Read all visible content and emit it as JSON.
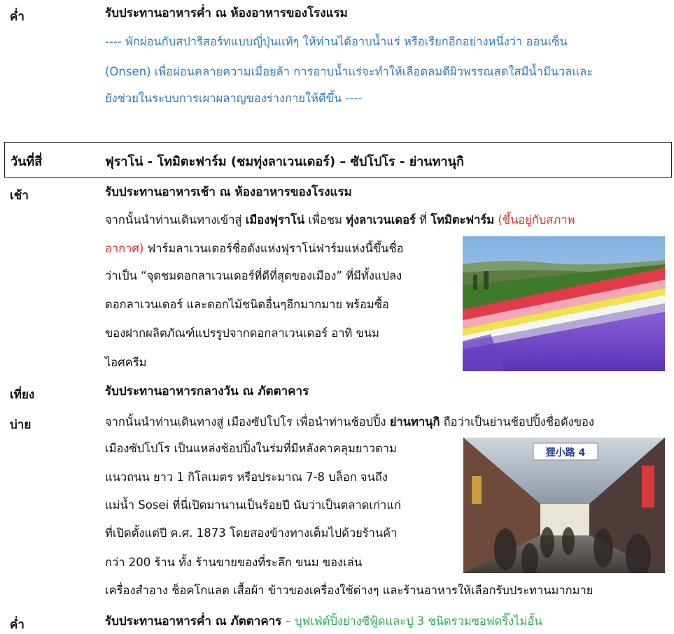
{
  "dinner1": {
    "label": "ค่ำ",
    "title": "รับประทานอาหารค่ำ ณ ห้องอาหารของโรงแรม",
    "note_lines": [
      "----  พักผ่อนกับสปารีสอร์ทแบบญี่ปุ่นแท้ๆ  ให้ท่านได้อาบน้ำแร่ หรือเรียกอีกอย่างหนึ่งว่า ออนเซ็น",
      "(Onsen) เพื่อผ่อนคลายความเมื่อยล้า การอาบน้ำแร่จะทำให้เลือดลมดีผิวพรรณสดใสมีน้ำมีนวลและ",
      "ยังช่วยในระบบการเผาผลาญของร่างกายให้ดีขึ้น ----"
    ]
  },
  "day4": {
    "label": "วันที่สี่",
    "title": "ฟุราโน่ - โทมิตะฟาร์ม (ชมทุ่งลาเวนเดอร์) – ซัปโปโร - ย่านทานุกิ"
  },
  "morning": {
    "label": "เช้า",
    "title": "รับประทานอาหารเช้า ณ ห้องอาหารของโรงแรม",
    "l1_a": "จากนั้นนำท่านเดินทางเข้าสู่ ",
    "l1_b": "เมืองฟุราโน่",
    "l1_c": " เพื่อชม ",
    "l1_d": "ทุ่งลาเวนเดอร์",
    "l1_e": " ที่ ",
    "l1_f": "โทมิตะฟาร์ม",
    "l1_g": " (ขึ้นอยู่กับสภาพ",
    "l2_red": "อากาศ)",
    "l2_rest": " ฟาร์มลาเวนเดอร์ชื่อดังแห่งฟุราโน่ฟาร์มแห่งนี้ขึ้นชื่อ",
    "lines": [
      "ว่าเป็น “จุดชมดอกลาเวนเดอร์ที่ดีที่สุดของเมือง” ที่มีทั้งแปลง",
      "ดอกลาเวนเดอร์ และดอกไม้ชนิดอื่นๆอีกมากมาย พร้อมซื้อ",
      "ของฝากผลิตภัณฑ์แปรรูปจากดอกลาเวนเดอร์ อาทิ ขนม",
      "ไอศครีม"
    ]
  },
  "lunch": {
    "label": "เที่ยง",
    "title": "รับประทานอาหารกลางวัน ณ ภัตตาคาร"
  },
  "afternoon": {
    "label": "บ่าย",
    "l1_a": "จากนั้นนำท่านเดินทางสู่ เมืองซัปโปโร เพื่อนำท่านช้อปปิ้ง ",
    "l1_b": "ย่านทานุกิ",
    "l1_c": " ถือว่าเป็นย่านช้อปปิ้งชื่อดังของ",
    "lines": [
      "เมืองซัปโปโร เป็นแหล่งช้อปปิ้งในร่มที่มีหลังคาคลุมยาวตาม",
      "แนวถนน ยาว 1 กิโลเมตร หรือประมาณ 7-8 บล็อก จนถึง",
      "แม่น้ำ Sosei ที่นี่เปิดมานานเป็นร้อยปี นับว่าเป็นตลาดเก่าแก่",
      "ที่เปิดตั้งแต่ปี ค.ศ. 1873 โดยสองข้างทางเต็มไปด้วยร้านค้า",
      "กว่า 200 ร้าน ทั้ง ร้านขายของที่ระลึก ขนม ของเล่น"
    ],
    "last_line": "เครื่องสำอาง ช็อคโกแลต เสื้อผ้า ข้าวของเครื่องใช้ต่างๆ และร้านอาหารให้เลือกรับประทานมากมาย",
    "sign_text": "狸小路 4"
  },
  "dinner2": {
    "label": "ค่ำ",
    "title": "รับประทานอาหารค่ำ ณ ภัตตาคาร",
    "extra": " – บุฟเฟ่ต์ปิ้งย่างซีฟู้ดและปู 3 ชนิดรวมซอฟดริ๊งไม่อั้น"
  },
  "colors": {
    "note_blue": "#2e7cc7",
    "weather_red": "#e0302a",
    "buffet_green": "#2fae4e"
  }
}
